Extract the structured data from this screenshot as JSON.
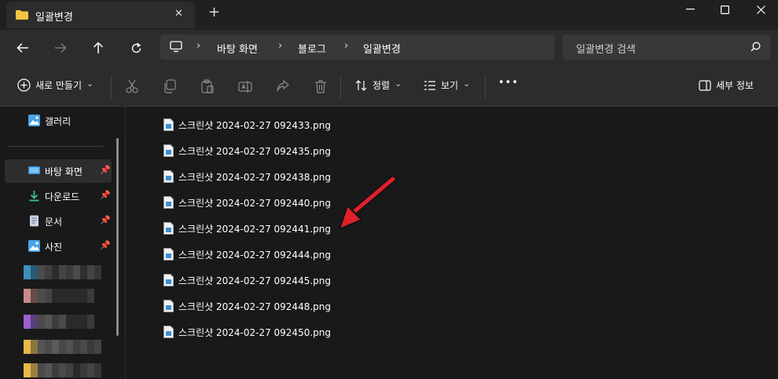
{
  "tab": {
    "title": "일괄변경",
    "close": "✕",
    "new": "+"
  },
  "window": {
    "minimize": "—",
    "maximize": "☐",
    "close": "✕"
  },
  "breadcrumb": {
    "sep": "›",
    "items": [
      "바탕 화면",
      "블로그",
      "일괄변경"
    ]
  },
  "search": {
    "placeholder": "일괄변경 검색"
  },
  "commands": {
    "new": "새로 만들기",
    "sort": "정렬",
    "view": "보기",
    "more": "•••",
    "details": "세부 정보",
    "dropdown": "⌄"
  },
  "sidebar": {
    "gallery": "갤러리",
    "pinned": [
      {
        "label": "바탕 화면",
        "pin": "📌"
      },
      {
        "label": "다운로드",
        "pin": "📌"
      },
      {
        "label": "문서",
        "pin": "📌"
      },
      {
        "label": "사진",
        "pin": "📌"
      }
    ]
  },
  "files": [
    "스크린샷 2024-02-27 092433.png",
    "스크린샷 2024-02-27 092435.png",
    "스크린샷 2024-02-27 092438.png",
    "스크린샷 2024-02-27 092440.png",
    "스크린샷 2024-02-27 092441.png",
    "스크린샷 2024-02-27 092444.png",
    "스크린샷 2024-02-27 092445.png",
    "스크린샷 2024-02-27 092448.png",
    "스크린샷 2024-02-27 092450.png"
  ],
  "colors": {
    "accent": "#e0202a",
    "folder": "#f4c542"
  }
}
